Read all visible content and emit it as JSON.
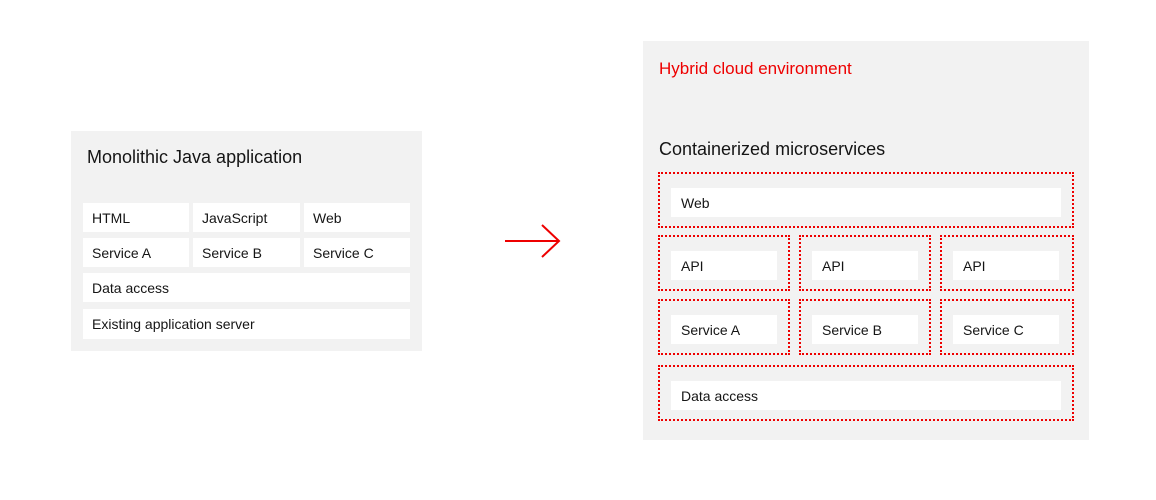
{
  "monolith": {
    "title": "Monolithic Java application",
    "row1": [
      "HTML",
      "JavaScript",
      "Web"
    ],
    "row2": [
      "Service A",
      "Service B",
      "Service C"
    ],
    "data_access": "Data access",
    "server": "Existing application server"
  },
  "arrow": {
    "icon": "arrow-right-icon",
    "color": "#ee0000"
  },
  "hybrid": {
    "environment_label": "Hybrid cloud environment",
    "title": "Containerized microservices",
    "web": "Web",
    "apis": [
      "API",
      "API",
      "API"
    ],
    "services": [
      "Service A",
      "Service B",
      "Service C"
    ],
    "data_access": "Data access"
  },
  "colors": {
    "accent": "#ee0000",
    "panel": "#f2f2f2",
    "text": "#151515"
  }
}
